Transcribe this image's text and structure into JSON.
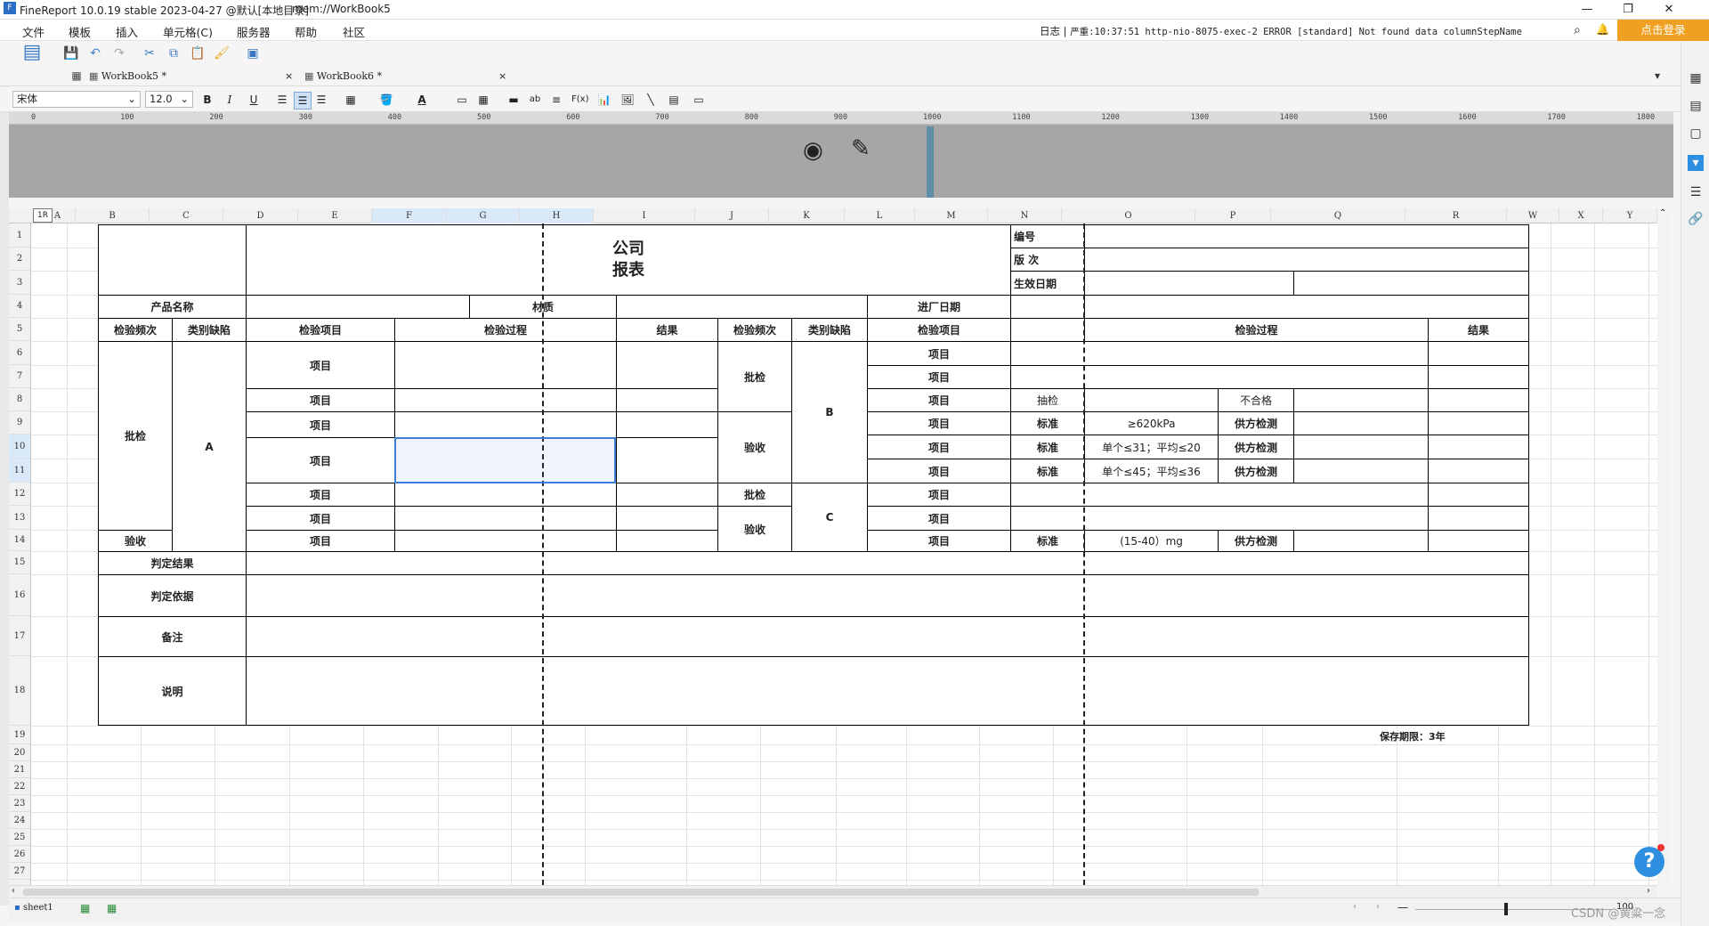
{
  "window": {
    "title": "FineReport 10.0.19 stable 2023-04-27 @默认[本地目录]",
    "path": "mem://WorkBook5",
    "minimize": "—",
    "maximize": "❐",
    "close": "✕"
  },
  "menu": {
    "items": [
      "文件",
      "模板",
      "插入",
      "单元格(C)",
      "服务器",
      "帮助",
      "社区"
    ],
    "log_label": "日志",
    "log_sep": "|",
    "log_message": "严重:10:37:51 http-nio-8075-exec-2 ERROR [standard] Not found data columnStepName",
    "login": "点击登录"
  },
  "tabs": [
    {
      "label": "WorkBook5 *",
      "close": "×"
    },
    {
      "label": "WorkBook6 *",
      "close": "×"
    }
  ],
  "format_toolbar": {
    "font_family": "宋体",
    "font_size": "12.0",
    "bold": "B",
    "italic": "I",
    "underline": "U"
  },
  "ruler_ticks": [
    "0",
    "100",
    "200",
    "300",
    "400",
    "500",
    "600",
    "700",
    "800",
    "900",
    "1000",
    "1100",
    "1200",
    "1300",
    "1400",
    "1500",
    "1600",
    "1700",
    "1800"
  ],
  "columns": [
    "A",
    "B",
    "C",
    "D",
    "E",
    "F",
    "G",
    "H",
    "I",
    "J",
    "K",
    "L",
    "M",
    "N",
    "O",
    "P",
    "Q",
    "R",
    "W",
    "X",
    "Y"
  ],
  "rows": [
    "1",
    "2",
    "3",
    "4",
    "5",
    "6",
    "7",
    "8",
    "9",
    "10",
    "11",
    "12",
    "13",
    "14",
    "15",
    "16",
    "17",
    "18",
    "19",
    "20",
    "21",
    "22",
    "23",
    "24",
    "25",
    "26",
    "27"
  ],
  "corner_label": "1R",
  "report": {
    "title_line1": "公司",
    "title_line2": "报表",
    "code_label": "编号",
    "version_label": "版 次",
    "effective_label": "生效日期",
    "product_label": "产品名称",
    "material_label": "材质",
    "entry_date_label": "进厂日期",
    "freq_header": "检验频次",
    "defect_header": "类别缺陷",
    "item_header": "检验项目",
    "process_header": "检验过程",
    "result_header": "结果",
    "item": "项目",
    "batch_check": "批检",
    "accept": "验收",
    "cat_a": "A",
    "cat_b": "B",
    "cat_c": "C",
    "spot_check": "抽检",
    "unqualified": "不合格",
    "standard": "标准",
    "supplier_test": "供方检测",
    "std1": "≥620kPa",
    "std2": "单个≤31；平均≤20",
    "std3": "单个≤45；平均≤36",
    "std4": "(15-40）mg",
    "judge_result": "判定结果",
    "judge_basis": "判定依据",
    "remarks": "备注",
    "explanation": "说明",
    "retention": "保存期限：3年"
  },
  "status": {
    "sheet": "sheet1",
    "zoom": "100",
    "watermark": "CSDN @黄粱一念"
  }
}
